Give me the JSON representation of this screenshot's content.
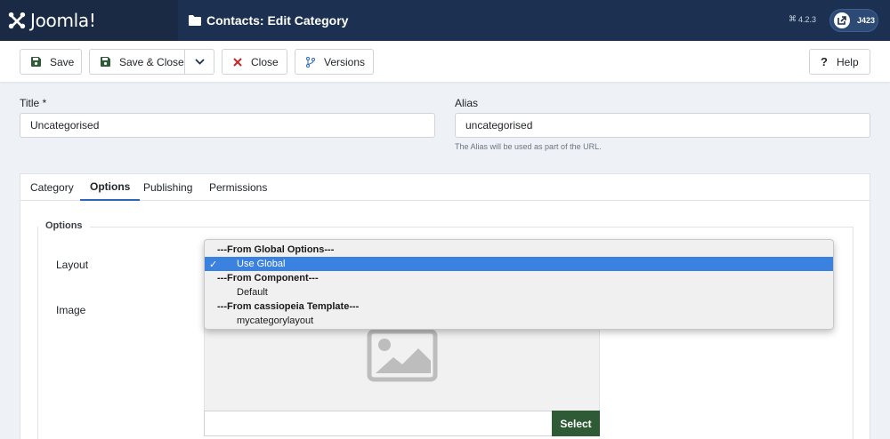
{
  "header": {
    "logo_text": "Joomla!",
    "title": "Contacts: Edit Category",
    "version": "4.2.3",
    "user_label": "J423"
  },
  "toolbar": {
    "save": "Save",
    "save_close": "Save & Close",
    "close": "Close",
    "versions": "Versions",
    "help": "Help"
  },
  "form": {
    "title_label": "Title *",
    "title_value": "Uncategorised",
    "alias_label": "Alias",
    "alias_value": "uncategorised",
    "alias_hint": "The Alias will be used as part of the URL."
  },
  "tabs": [
    "Category",
    "Options",
    "Publishing",
    "Permissions"
  ],
  "active_tab": "Options",
  "options": {
    "legend": "Options",
    "layout_label": "Layout",
    "image_label": "Image",
    "select_button": "Select"
  },
  "dropdown": {
    "check": "✓",
    "rows": [
      {
        "type": "group",
        "label": "---From Global Options---"
      },
      {
        "type": "option",
        "label": "Use Global",
        "selected": true
      },
      {
        "type": "group",
        "label": "---From Component---"
      },
      {
        "type": "option",
        "label": "Default"
      },
      {
        "type": "group",
        "label": "---From cassiopeia Template---"
      },
      {
        "type": "option",
        "label": "mycategorylayout"
      }
    ]
  },
  "colors": {
    "header": "#1c3152",
    "select_button": "#2e5b35",
    "highlight": "#3b82e0",
    "close_icon": "#c52827"
  }
}
